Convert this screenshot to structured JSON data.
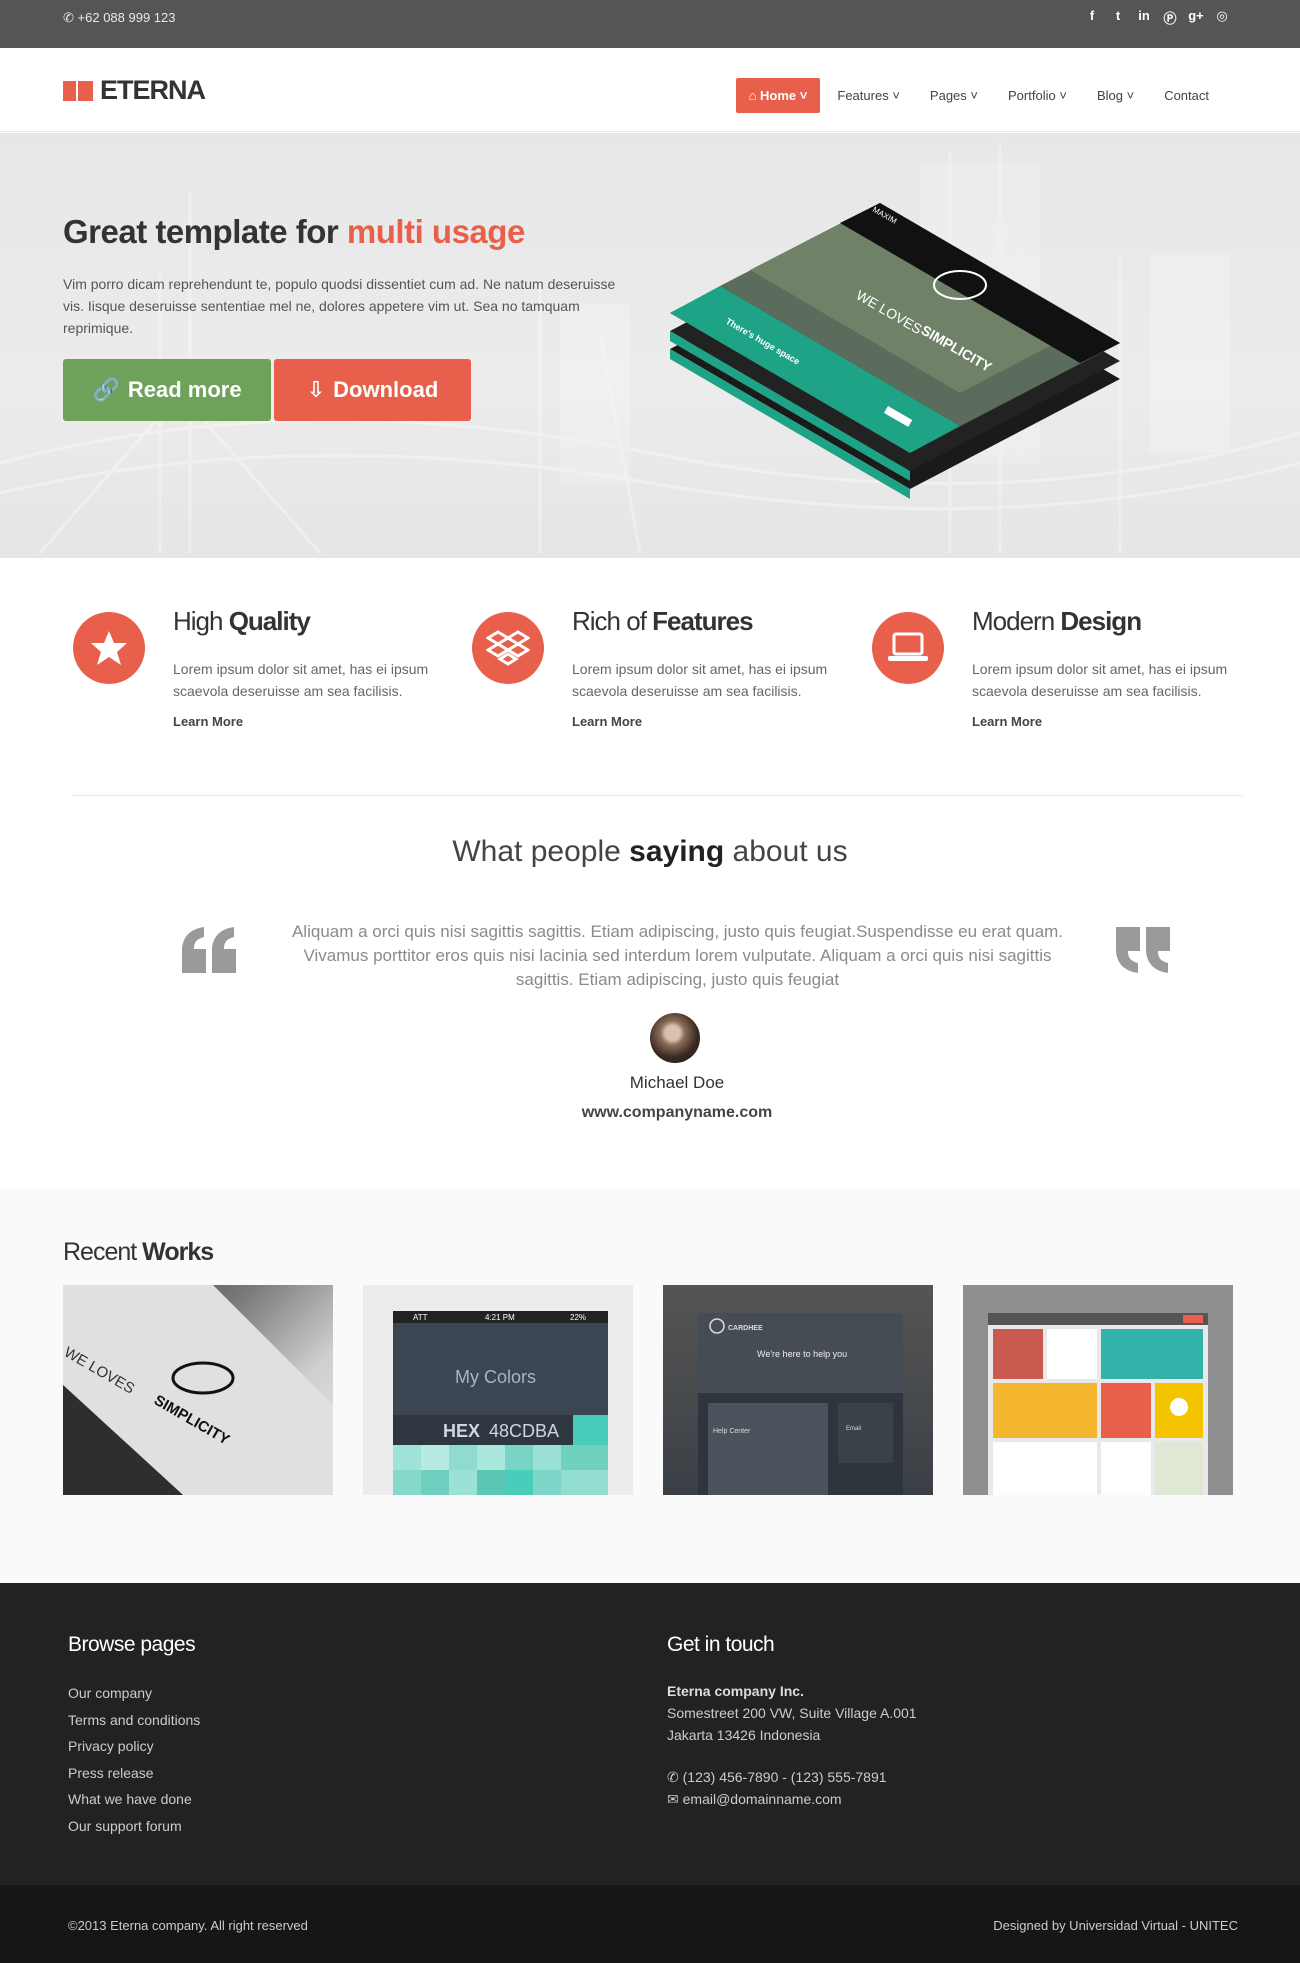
{
  "topbar": {
    "phone": "+62 088 999 123",
    "social": [
      "facebook-icon",
      "twitter-icon",
      "linkedin-icon",
      "pinterest-icon",
      "google-plus-icon",
      "dribbble-icon"
    ]
  },
  "header": {
    "logo": "ETERNA",
    "nav": [
      {
        "label": "Home",
        "active": true
      },
      {
        "label": "Features"
      },
      {
        "label": "Pages"
      },
      {
        "label": "Portfolio"
      },
      {
        "label": "Blog"
      },
      {
        "label": "Contact"
      }
    ]
  },
  "hero": {
    "title_pre": "Great template for ",
    "title_accent": "multi usage",
    "text": "Vim porro dicam reprehendunt te, populo quodsi dissentiet cum ad. Ne natum deseruisse vis. Iisque deseruisse sententiae mel ne, dolores appetere vim ut. Sea no tamquam reprimique.",
    "btn_read": "Read more",
    "btn_download": "Download",
    "mock_brand": "MAXIM",
    "mock_tagline_1": "WE LOVES",
    "mock_tagline_2": "SIMPLICITY",
    "mock_band": "There's huge space"
  },
  "features": [
    {
      "title_light": "High ",
      "title_bold": "Quality",
      "icon": "star-icon",
      "desc": "Lorem ipsum dolor sit amet, has ei ipsum scaevola deseruisse am sea facilisis.",
      "link": "Learn More"
    },
    {
      "title_light": "Rich of ",
      "title_bold": "Features",
      "icon": "dropbox-icon",
      "desc": "Lorem ipsum dolor sit amet, has ei ipsum scaevola deseruisse am sea facilisis.",
      "link": "Learn More"
    },
    {
      "title_light": "Modern ",
      "title_bold": "Design",
      "icon": "laptop-icon",
      "desc": "Lorem ipsum dolor sit amet, has ei ipsum scaevola deseruisse am sea facilisis.",
      "link": "Learn More"
    }
  ],
  "testimonial": {
    "title_pre": "What people ",
    "title_bold": "saying",
    "title_post": " about us",
    "text": "Aliquam a orci quis nisi sagittis sagittis. Etiam adipiscing, justo quis feugiat.Suspendisse eu erat quam. Vivamus porttitor eros quis nisi lacinia sed interdum lorem vulputate. Aliquam a orci quis nisi sagittis sagittis. Etiam adipiscing, justo quis feugiat",
    "name": "Michael Doe",
    "url": "www.companyname.com"
  },
  "works": {
    "title_light": "Recent ",
    "title_bold": "Works",
    "w1_tagline_1": "WE LOVES",
    "w1_tagline_2": "SIMPLICITY",
    "w2_carrier": "ATT",
    "w2_time": "4:21 PM",
    "w2_battery": "22%",
    "w2_title": "My Colors",
    "w2_hex_label": "HEX",
    "w2_hex_value": "48CDBA",
    "w3_brand": "CARDHEE",
    "w3_hero": "We're here to help you",
    "w3_help": "Help Center",
    "w3_email": "Email"
  },
  "footer": {
    "browse_title": "Browse pages",
    "links": [
      "Our company",
      "Terms and conditions",
      "Privacy policy",
      "Press release",
      "What we have done",
      "Our support forum"
    ],
    "contact_title": "Get in touch",
    "company": "Eterna company Inc.",
    "address1": "Somestreet 200 VW, Suite Village A.001",
    "address2": "Jakarta 13426 Indonesia",
    "phone": "(123) 456-7890 - (123) 555-7891",
    "email": "email@domainname.com"
  },
  "bottombar": {
    "copyright": "©2013 Eterna company. All right reserved",
    "credit": "Designed by Universidad Virtual - UNITEC"
  },
  "colors": {
    "accent": "#e8604c",
    "green": "#6ea25a",
    "teal": "#1fa386",
    "footer": "#222222"
  }
}
